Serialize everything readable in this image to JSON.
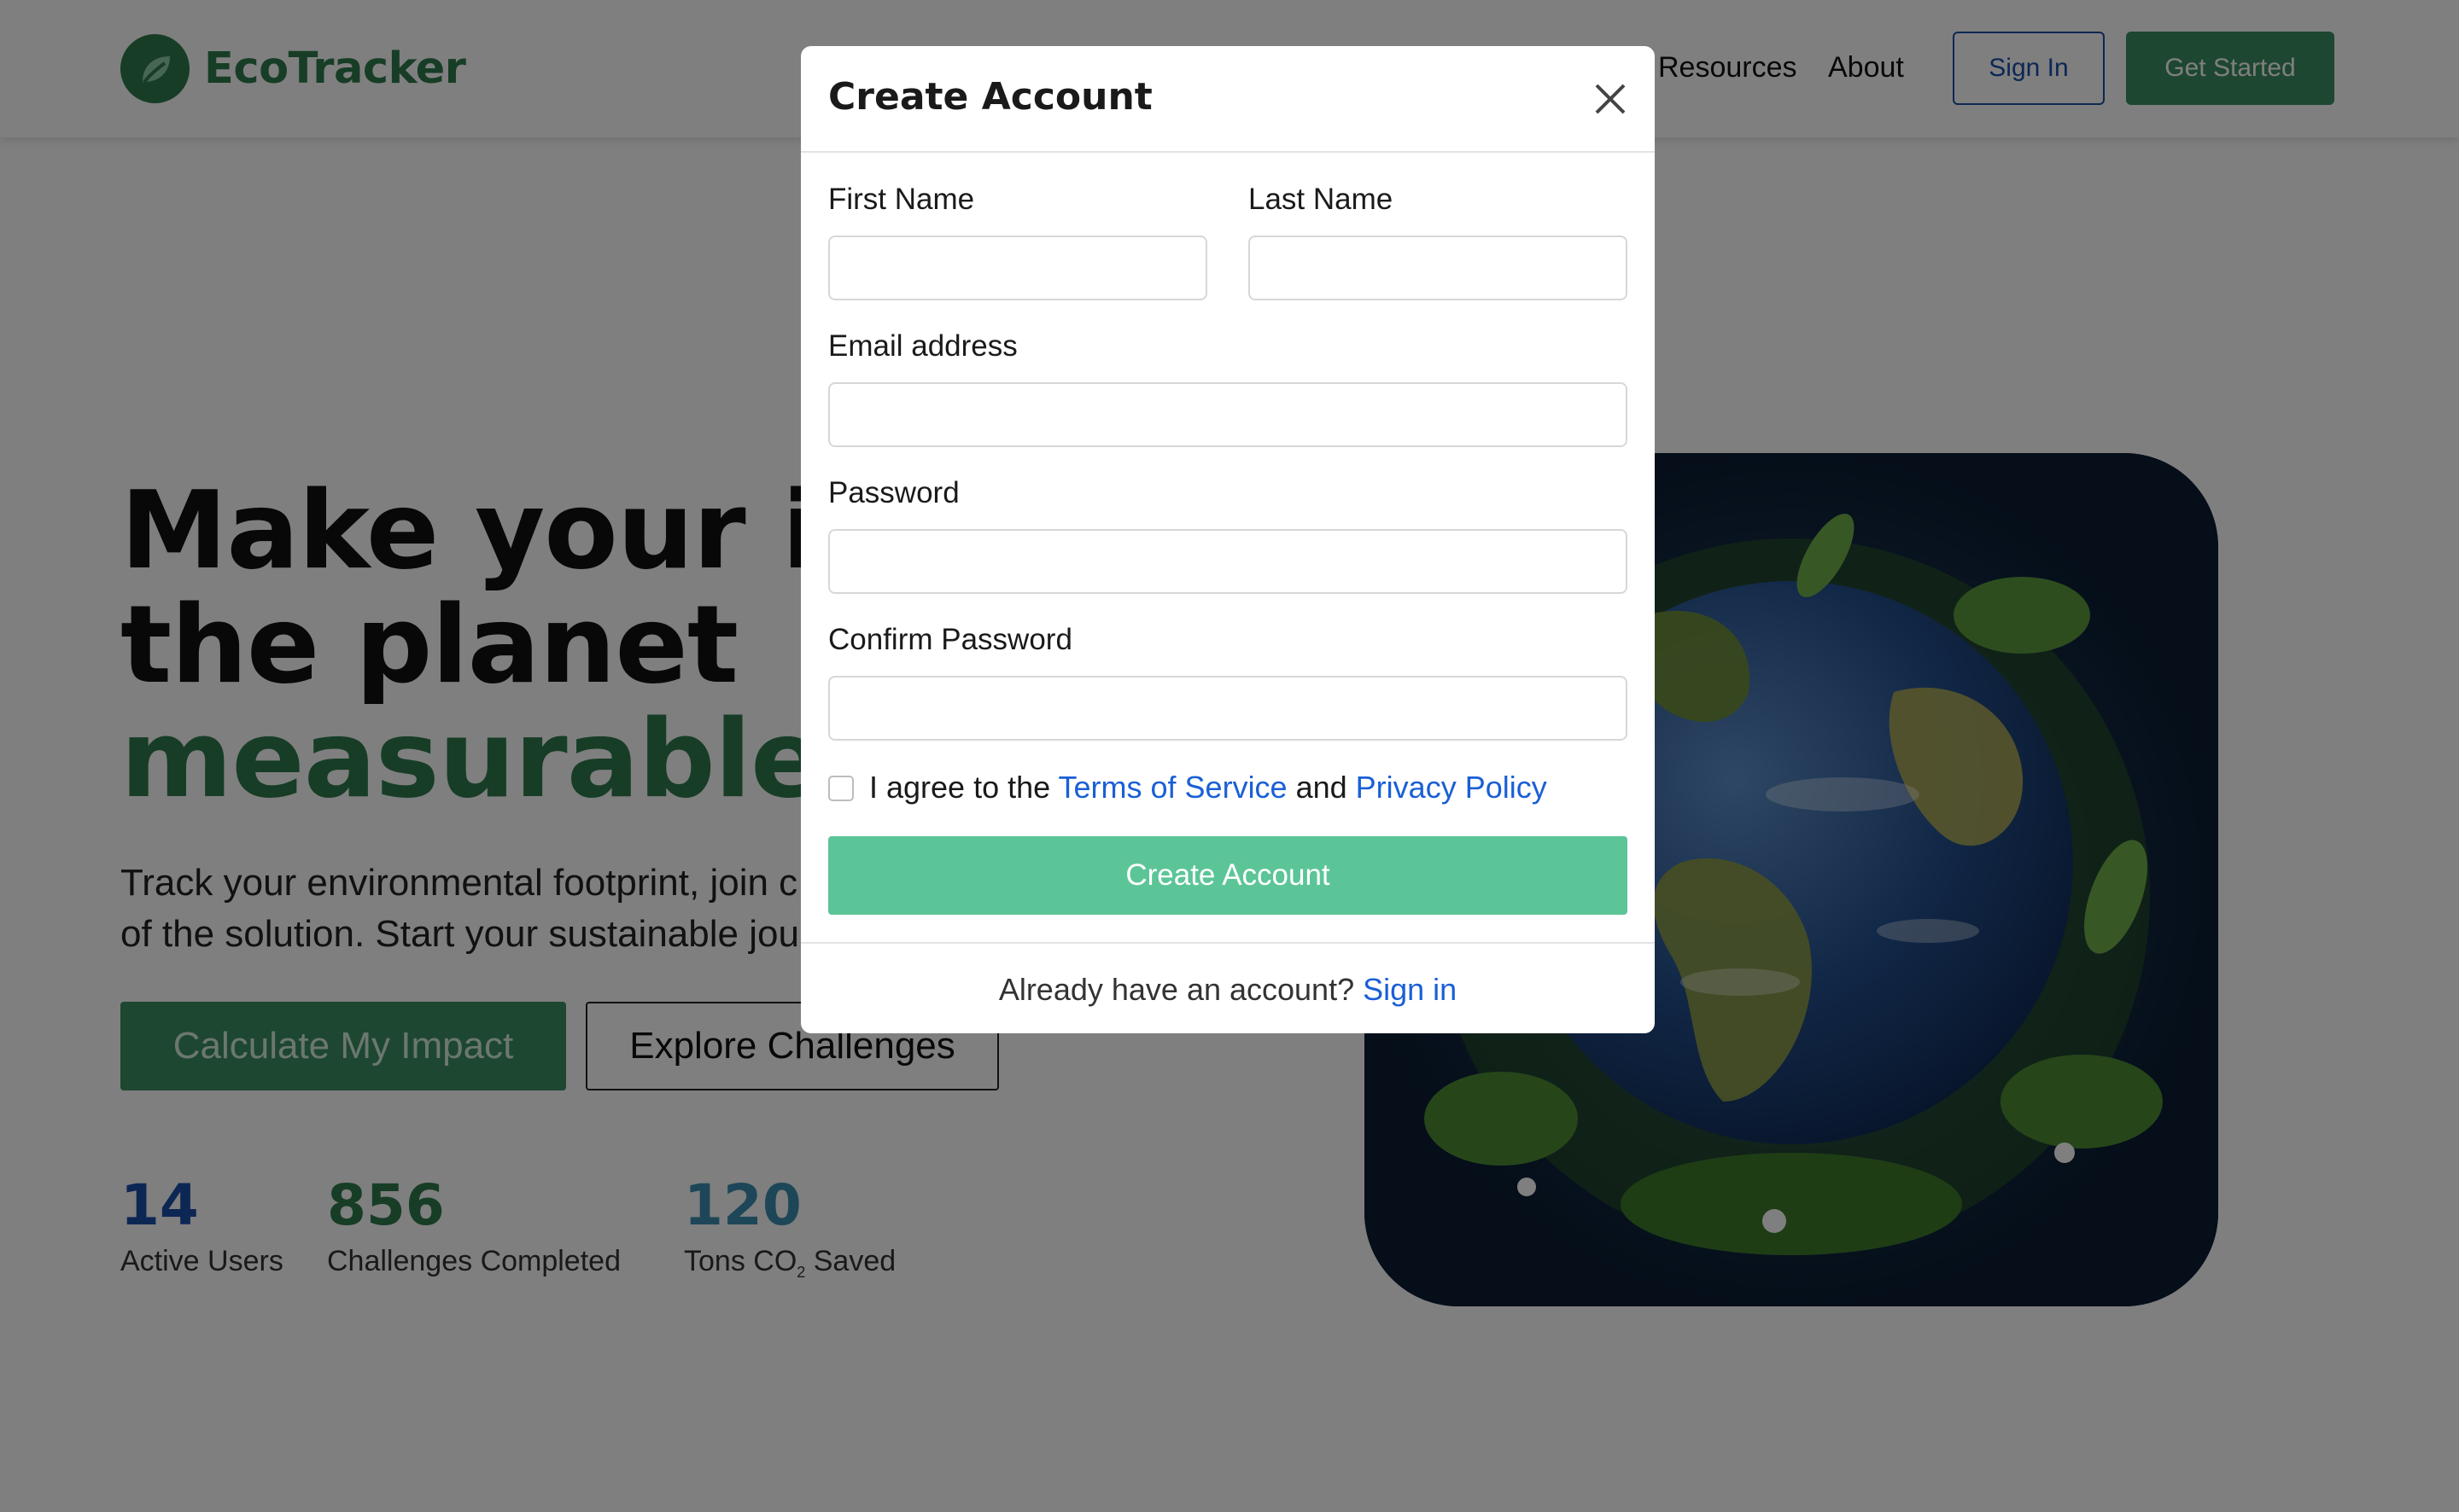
{
  "brand": {
    "name": "EcoTracker",
    "logo_icon": "leaf-icon"
  },
  "nav": {
    "links": [
      "Resources",
      "About"
    ],
    "sign_in_label": "Sign In",
    "get_started_label": "Get Started"
  },
  "hero": {
    "title_line1": "Make your im",
    "title_line2": "the planet",
    "title_accent": "measurable",
    "subtitle_line1": "Track your environmental footprint, join c",
    "subtitle_line2": "of the solution. Start your sustainable jou",
    "primary_button": "Calculate My Impact",
    "secondary_button": "Explore Challenges"
  },
  "stats": [
    {
      "value": "14",
      "label": "Active Users"
    },
    {
      "value": "856",
      "label": "Challenges Completed"
    },
    {
      "value": "120",
      "label_prefix": "Tons CO",
      "label_sub": "2",
      "label_suffix": " Saved"
    }
  ],
  "modal": {
    "title": "Create Account",
    "close_icon": "close-icon",
    "fields": {
      "first_name": {
        "label": "First Name",
        "value": "",
        "placeholder": ""
      },
      "last_name": {
        "label": "Last Name",
        "value": "",
        "placeholder": ""
      },
      "email": {
        "label": "Email address",
        "value": "",
        "placeholder": ""
      },
      "password": {
        "label": "Password",
        "value": "",
        "placeholder": ""
      },
      "confirm_password": {
        "label": "Confirm Password",
        "value": "",
        "placeholder": ""
      }
    },
    "agree": {
      "prefix": "I agree to the ",
      "terms_link": "Terms of Service",
      "middle": " and ",
      "privacy_link": "Privacy Policy",
      "checked": false
    },
    "submit_label": "Create Account",
    "footer_text": "Already have an account? ",
    "footer_link": "Sign in"
  },
  "colors": {
    "brand_green": "#2f7a4c",
    "button_green": "#3a8f60",
    "submit_green": "#5cc597",
    "link_blue": "#1a5fd6",
    "stat_blue": "#1a4fa8",
    "stat_teal": "#3a8fb0"
  }
}
